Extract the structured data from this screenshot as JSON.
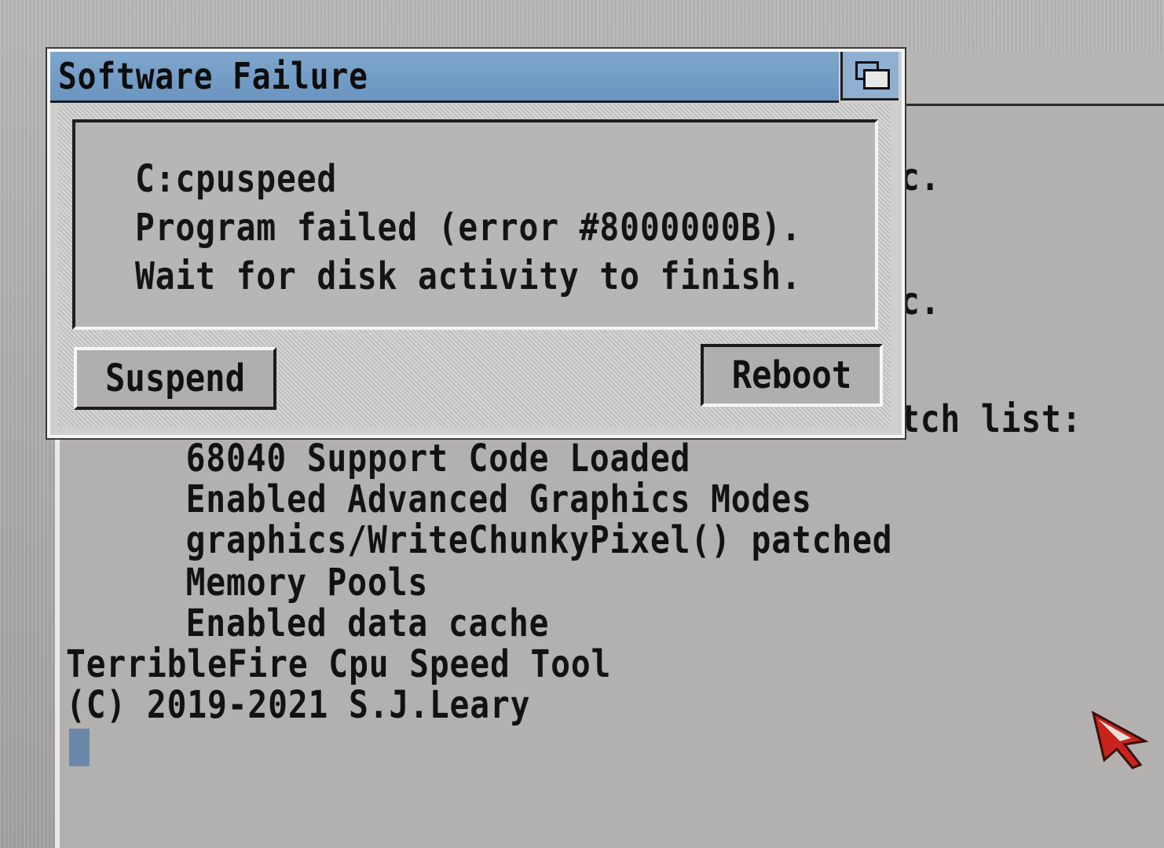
{
  "requester": {
    "title": "Software Failure",
    "message_lines": [
      "C:cpuspeed",
      "Program failed (error #8000000B).",
      "Wait for disk activity to finish."
    ],
    "buttons": {
      "suspend": "Suspend",
      "reboot": "Reboot"
    }
  },
  "shell": {
    "partial_right": [
      "c.",
      "c.",
      "tch list:"
    ],
    "lines": [
      "     68040 Support Code Loaded",
      "     Enabled Advanced Graphics Modes",
      "     graphics/WriteChunkyPixel() patched",
      "     Memory Pools",
      "     Enabled data cache",
      "TerribleFire Cpu Speed Tool",
      "(C) 2019-2021 S.J.Leary"
    ]
  },
  "colors": {
    "titlebar": "#6a95c0",
    "cursor": "#6c88a8",
    "pointer": "#c8241c"
  }
}
